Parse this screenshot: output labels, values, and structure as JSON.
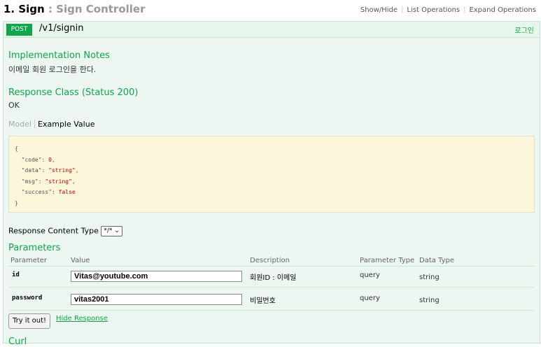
{
  "header": {
    "title_number": "1. Sign",
    "title_sep": " : ",
    "title_sub": "Sign Controller",
    "links": [
      "Show/Hide",
      "List Operations",
      "Expand Operations"
    ]
  },
  "operation": {
    "method": "POST",
    "path": "/v1/signin",
    "summary": "로그인",
    "implementation_notes_heading": "Implementation Notes",
    "implementation_notes": "이메일 회원 로그인을 한다.",
    "response_class_heading": "Response Class (Status 200)",
    "response_class_value": "OK",
    "model_tab": "Model",
    "example_tab": "Example Value",
    "example": {
      "open": "{",
      "code_key": "  \"code\": ",
      "code_val": "0",
      "data_key": "  \"data\": ",
      "data_val": "\"string\"",
      "msg_key": "  \"msg\": ",
      "msg_val": "\"string\"",
      "success_key": "  \"success\": ",
      "success_val": "false",
      "close": "}"
    },
    "response_content_type_label": "Response Content Type",
    "response_content_type_value": "*/*",
    "parameters_heading": "Parameters",
    "columns": [
      "Parameter",
      "Value",
      "Description",
      "Parameter Type",
      "Data Type"
    ],
    "params": [
      {
        "name": "id",
        "value": "Vitas@youtube.com",
        "description": "회원ID : 이메일",
        "param_type": "query",
        "data_type": "string"
      },
      {
        "name": "password",
        "value": "vitas2001",
        "description": "비밀번호",
        "param_type": "query",
        "data_type": "string"
      }
    ],
    "try_button": "Try it out!",
    "hide_response": "Hide Response",
    "curl_heading": "Curl"
  },
  "colors": {
    "accent": "#10a54a",
    "op_background": "#ebf7f0",
    "code_background": "#fcf6db"
  }
}
